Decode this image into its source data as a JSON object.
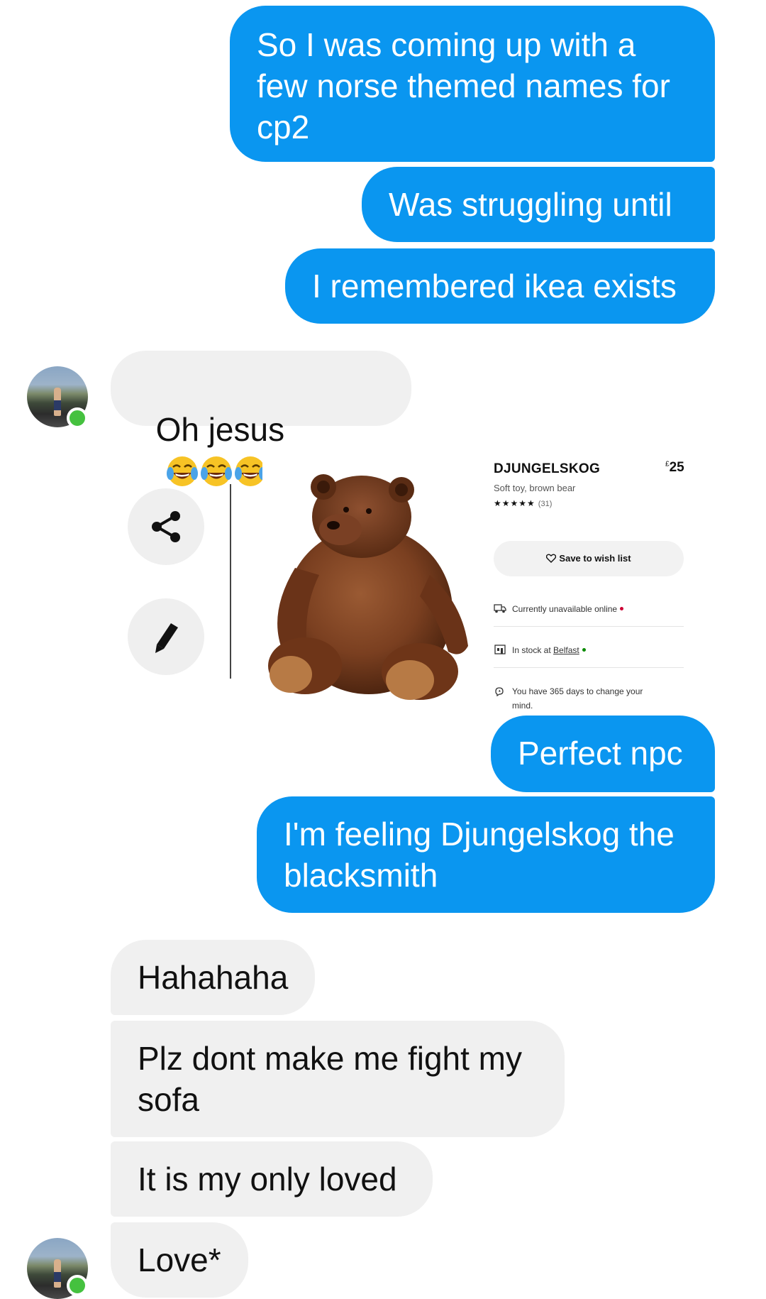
{
  "colors": {
    "sent_bubble": "#0a96f0",
    "received_bubble": "#f0f0f0",
    "online_indicator": "#45c13f"
  },
  "messages": [
    {
      "side": "sent",
      "text": "So I was coming up with a\nfew norse themed names for\ncp2"
    },
    {
      "side": "sent",
      "text": "Was struggling until"
    },
    {
      "side": "sent",
      "text": "I remembered ikea exists"
    },
    {
      "side": "received",
      "text": "Oh jesus",
      "emoji": [
        "face-with-tears-of-joy",
        "face-with-tears-of-joy",
        "face-with-tears-of-joy"
      ]
    },
    {
      "side": "sent",
      "text": "Perfect npc"
    },
    {
      "side": "sent",
      "text": "I'm feeling Djungelskog the\nblacksmith"
    },
    {
      "side": "received",
      "text": "Hahahaha"
    },
    {
      "side": "received",
      "text": "Plz dont make me fight my\nsofa"
    },
    {
      "side": "received",
      "text": "It is my only loved"
    },
    {
      "side": "received",
      "text": "Love*"
    }
  ],
  "media_actions": {
    "share_icon": "share-icon",
    "edit_icon": "pencil-icon"
  },
  "product_card": {
    "name": "DJUNGELSKOG",
    "currency": "£",
    "price": "25",
    "description": "Soft toy, brown bear",
    "stars": "★★★★★",
    "rating": 5,
    "review_count": "(31)",
    "wish_button": "Save to wish list",
    "online_status": "Currently unavailable online",
    "store_status_prefix": "In stock at ",
    "store_name": "Belfast",
    "returns_line1": "You have 365 days to change your",
    "returns_line2": "mind."
  }
}
